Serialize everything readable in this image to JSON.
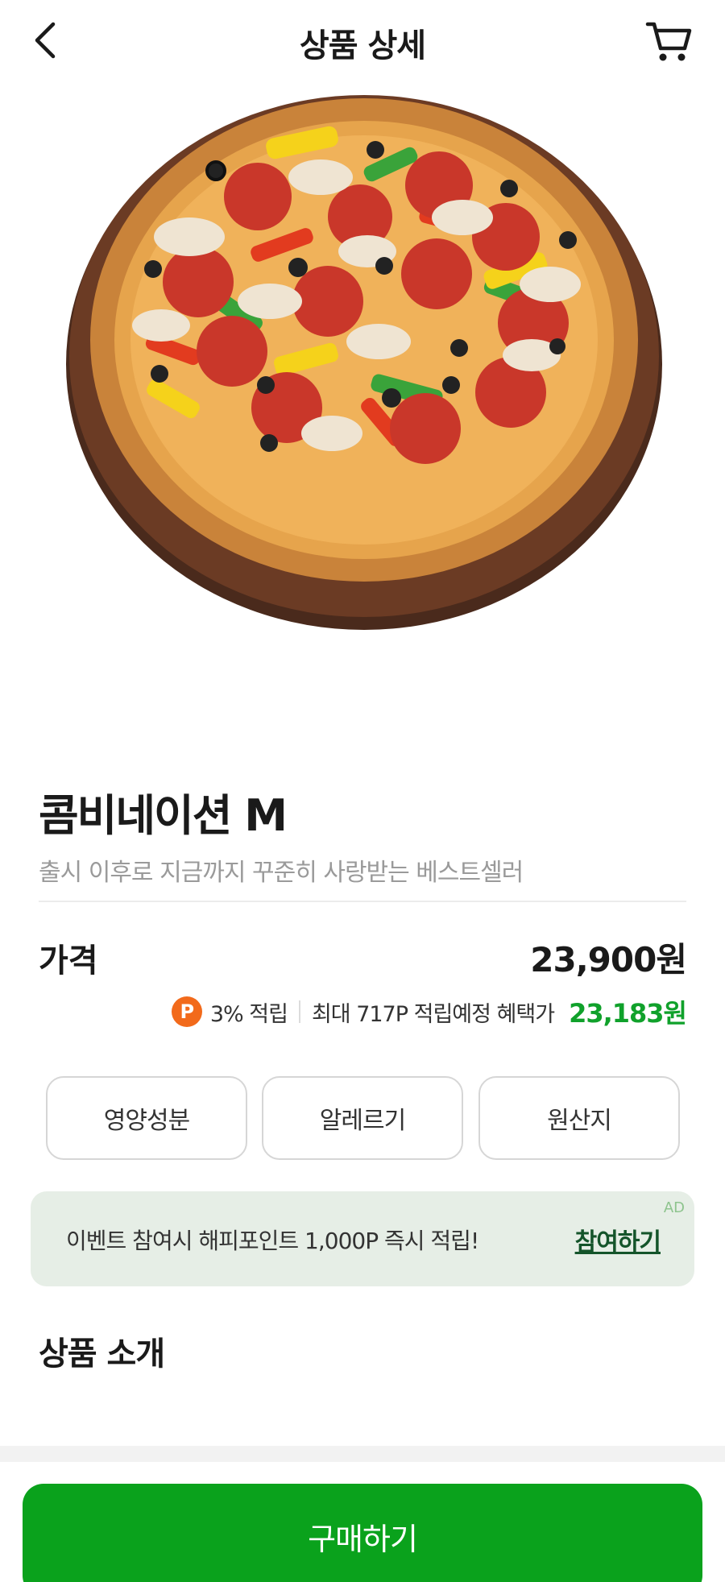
{
  "header": {
    "title": "상품 상세",
    "back_icon": "chevron-left-icon",
    "cart_icon": "cart-icon"
  },
  "product": {
    "name": "콤비네이션 M",
    "description": "출시 이후로 지금까지 꾸준히 사랑받는 베스트셀러",
    "image": "pizza-photo"
  },
  "price": {
    "label": "가격",
    "value": "23,900원",
    "point_badge": "P",
    "point_rate": "3% 적립",
    "max_point_text": "최대 717P 적립예정 혜택가",
    "benefit_price": "23,183원",
    "benefit_color": "#10a12b"
  },
  "info_buttons": [
    {
      "label": "영양성분"
    },
    {
      "label": "알레르기"
    },
    {
      "label": "원산지"
    }
  ],
  "ad_banner": {
    "tag": "AD",
    "text": "이벤트 참여시 해피포인트 1,000P 즉시 적립!",
    "link": "참여하기"
  },
  "section": {
    "title": "상품 소개"
  },
  "footer": {
    "buy_label": "구매하기",
    "accent_color": "#0aa21c"
  }
}
